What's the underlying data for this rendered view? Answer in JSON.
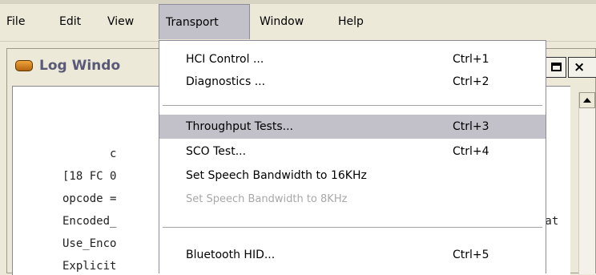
{
  "menubar": {
    "items": [
      {
        "label": "File"
      },
      {
        "label": "Edit"
      },
      {
        "label": "View"
      },
      {
        "label": "Transport"
      },
      {
        "label": "Window"
      },
      {
        "label": "Help"
      }
    ]
  },
  "child_window": {
    "title": "Log Windo",
    "maximize_glyph": "□",
    "close_glyph": "×",
    "log_lines": [
      "       c",
      "[18 FC 0",
      "opcode =",
      "Encoded_",
      "Use_Enco",
      "Explicit"
    ],
    "right_fragment": "Rat"
  },
  "transport_menu": {
    "items": [
      {
        "label": "HCI Control ...",
        "shortcut": "Ctrl+1"
      },
      {
        "label": "Diagnostics ...",
        "shortcut": "Ctrl+2"
      },
      {
        "label": "Throughput Tests...",
        "shortcut": "Ctrl+3"
      },
      {
        "label": "SCO Test...",
        "shortcut": "Ctrl+4"
      },
      {
        "label": "Set Speech Bandwidth to 16KHz",
        "shortcut": ""
      },
      {
        "label": "Set Speech Bandwidth to 8KHz",
        "shortcut": ""
      },
      {
        "label": "Bluetooth HID...",
        "shortcut": "Ctrl+5"
      }
    ]
  }
}
